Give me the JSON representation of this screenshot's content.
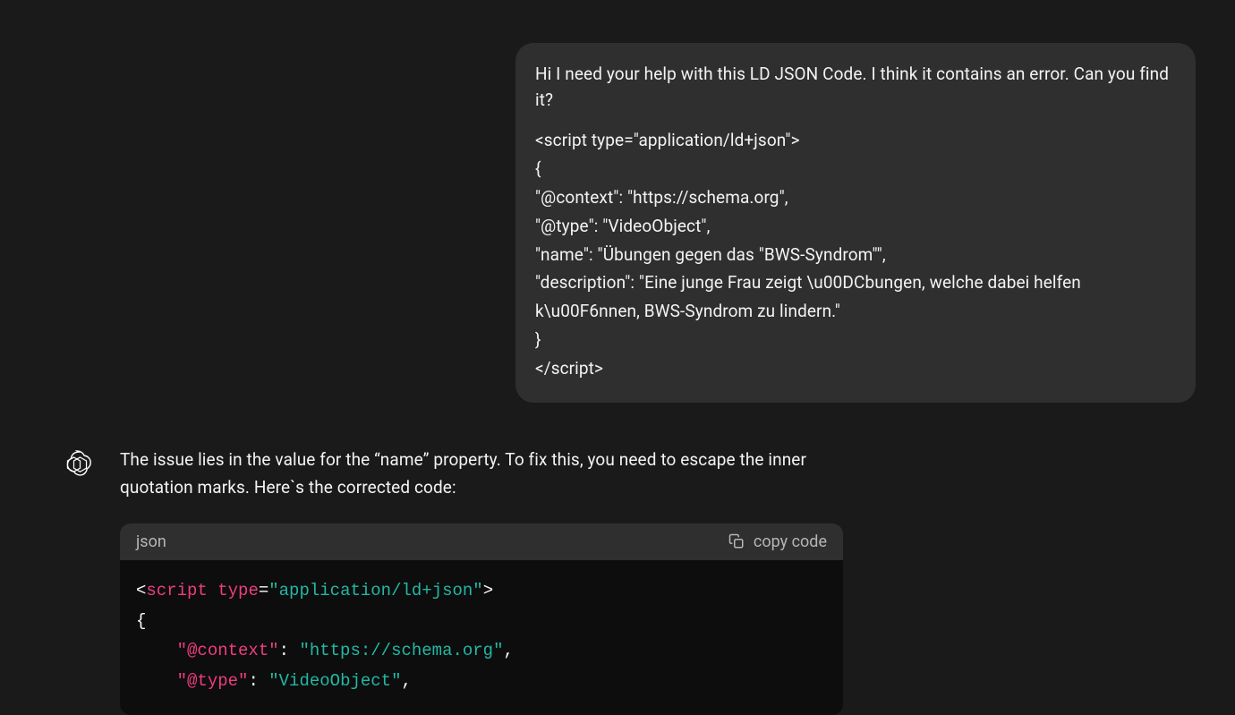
{
  "user": {
    "prompt": "Hi I need your help with this LD JSON Code. I think it contains an error. Can you find it?",
    "code_l1": "<script type=\"application/ld+json\">",
    "code_l2": "  {",
    "code_l3": "   \"@context\": \"https://schema.org\",",
    "code_l4": "   \"@type\": \"VideoObject\",",
    "code_l5": "   \"name\": \"Übungen gegen das \"BWS-Syndrom\"\",",
    "code_l6": "   \"description\": \"Eine junge Frau zeigt \\u00DCbungen, welche dabei helfen k\\u00F6nnen, BWS-Syndrom zu lindern.\"",
    "code_l7": "  }",
    "code_l8": "  </script>"
  },
  "assistant": {
    "text": "The issue lies in the value for the “name” property. To fix this, you need to escape the inner quotation marks. Here`s the corrected code:",
    "code_lang": "json",
    "copy_label": "copy code",
    "code": {
      "l1_open": "<",
      "l1_tag": "script",
      "l1_type": "type",
      "l1_eq": "=",
      "l1_val": "\"application/ld+json\"",
      "l1_close": ">",
      "l2": "{",
      "l3_key": "\"@context\"",
      "l3_colon": ":",
      "l3_val": "\"https://schema.org\"",
      "l3_comma": ",",
      "l4_key": "\"@type\"",
      "l4_colon": ":",
      "l4_val": "\"VideoObject\"",
      "l4_comma": ","
    }
  }
}
